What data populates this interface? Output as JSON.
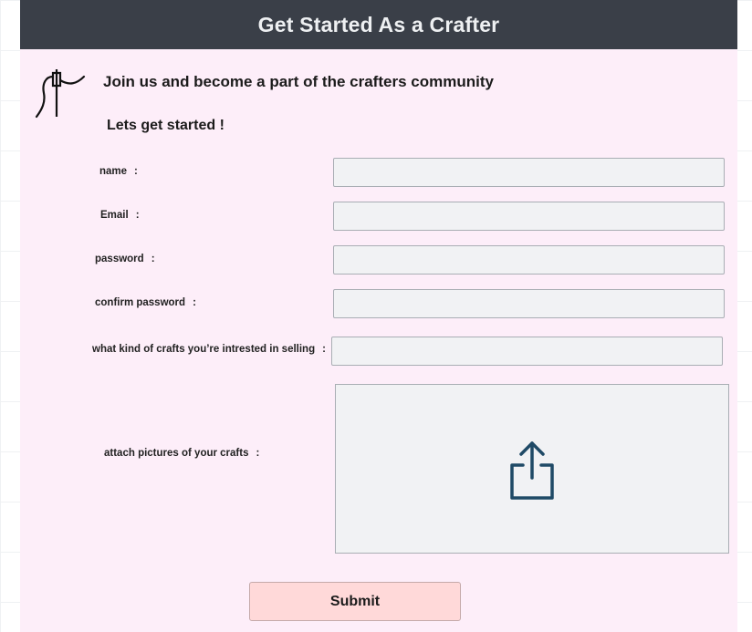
{
  "header": {
    "title": "Get Started As a Crafter"
  },
  "intro": {
    "tagline": "Join us and become a part of the crafters community",
    "subheading": "Lets get started !",
    "logo_icon": "needle-thread-icon"
  },
  "form": {
    "name_label": "name",
    "email_label": "Email",
    "password_label": "password",
    "confirm_password_label": "confirm password",
    "crafts_label": "what kind of crafts you’re intrested in selling",
    "attach_label": "attach pictures of your crafts",
    "colon": ":",
    "name_value": "",
    "email_value": "",
    "password_value": "",
    "confirm_password_value": "",
    "crafts_value": "",
    "upload_icon": "upload-share-icon"
  },
  "actions": {
    "submit_label": "Submit"
  },
  "colors": {
    "header_bg": "#3a3f48",
    "card_bg": "#fdeef9",
    "input_bg": "#f1f2f4",
    "submit_bg": "#ffd9d9",
    "upload_icon": "#1f4a66"
  }
}
